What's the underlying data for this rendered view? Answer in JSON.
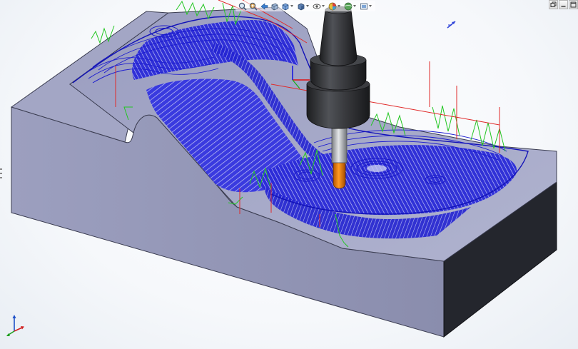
{
  "viewport": {
    "name": "graphics-area",
    "background": "#ffffff"
  },
  "colors": {
    "stock_top": "#a6aac8",
    "stock_side_left": "#a0a3c3",
    "stock_side_front": "#888bab",
    "stock_side_right": "#24262d",
    "toolpath_blue": "#1f1fd6",
    "rapid_green": "#22c622",
    "link_red": "#e02a2a",
    "tool_holder": "#2f3033",
    "tool_shank": "#b5b8bc",
    "tool_flute": "#f07c00"
  },
  "toolbar": {
    "icons": [
      "zoom-to-fit-icon",
      "zoom-area-icon",
      "previous-view-icon",
      "section-view-icon",
      "view-orientation-icon",
      "display-style-icon",
      "hide-show-items-icon",
      "edit-appearance-icon",
      "apply-scene-icon",
      "view-settings-icon"
    ]
  },
  "window_controls": {
    "icons": [
      "restore-viewport-icon",
      "minimize-viewport-icon",
      "maximize-viewport-icon"
    ]
  },
  "reference_triad": {
    "axes": [
      "x-axis",
      "y-axis",
      "z-axis"
    ]
  },
  "scene": {
    "objects": [
      "machined-stock-block",
      "3d-toolpath",
      "cutting-tool"
    ]
  }
}
